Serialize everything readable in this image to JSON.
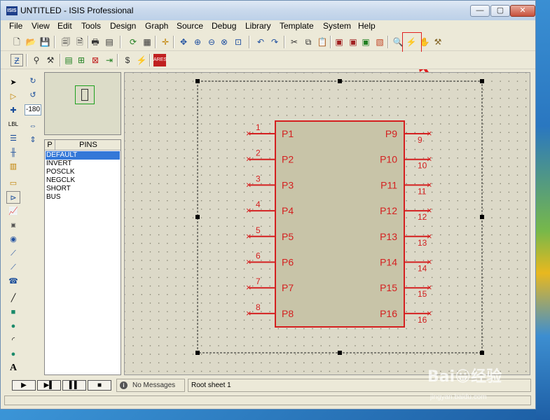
{
  "window": {
    "app_icon": "ISIS",
    "title": "UNTITLED - ISIS Professional",
    "minimize": "—",
    "maximize": "▢",
    "close": "✕"
  },
  "menu": [
    "File",
    "View",
    "Edit",
    "Tools",
    "Design",
    "Graph",
    "Source",
    "Debug",
    "Library",
    "Template",
    "System",
    "Help"
  ],
  "rotation": {
    "angle": "-180"
  },
  "device_list": {
    "p_button": "P",
    "title": "PINS",
    "items": [
      "DEFAULT",
      "INVERT",
      "POSCLK",
      "NEGCLK",
      "SHORT",
      "BUS"
    ],
    "selected_index": 0
  },
  "component": {
    "left_pins": [
      {
        "num": "1",
        "name": "P1"
      },
      {
        "num": "2",
        "name": "P2"
      },
      {
        "num": "3",
        "name": "P3"
      },
      {
        "num": "4",
        "name": "P4"
      },
      {
        "num": "5",
        "name": "P5"
      },
      {
        "num": "6",
        "name": "P6"
      },
      {
        "num": "7",
        "name": "P7"
      },
      {
        "num": "8",
        "name": "P8"
      }
    ],
    "right_pins": [
      {
        "num": "9",
        "name": "P9"
      },
      {
        "num": "10",
        "name": "P10"
      },
      {
        "num": "11",
        "name": "P11"
      },
      {
        "num": "12",
        "name": "P12"
      },
      {
        "num": "13",
        "name": "P13"
      },
      {
        "num": "14",
        "name": "P14"
      },
      {
        "num": "15",
        "name": "P15"
      },
      {
        "num": "16",
        "name": "P16"
      }
    ],
    "color": "#d42020",
    "body_color": "#c8c4a8"
  },
  "status": {
    "play": "▶",
    "step": "▶▌",
    "pause": "▌▌",
    "stop": "■",
    "messages_icon": "i",
    "messages": "No Messages",
    "sheet": "Root sheet 1"
  },
  "watermark": {
    "main": "Bai😀经验",
    "sub": "jingyan.baidu.com"
  },
  "colors": {
    "accent_red": "#e02020",
    "selection_blue": "#3478d8"
  }
}
